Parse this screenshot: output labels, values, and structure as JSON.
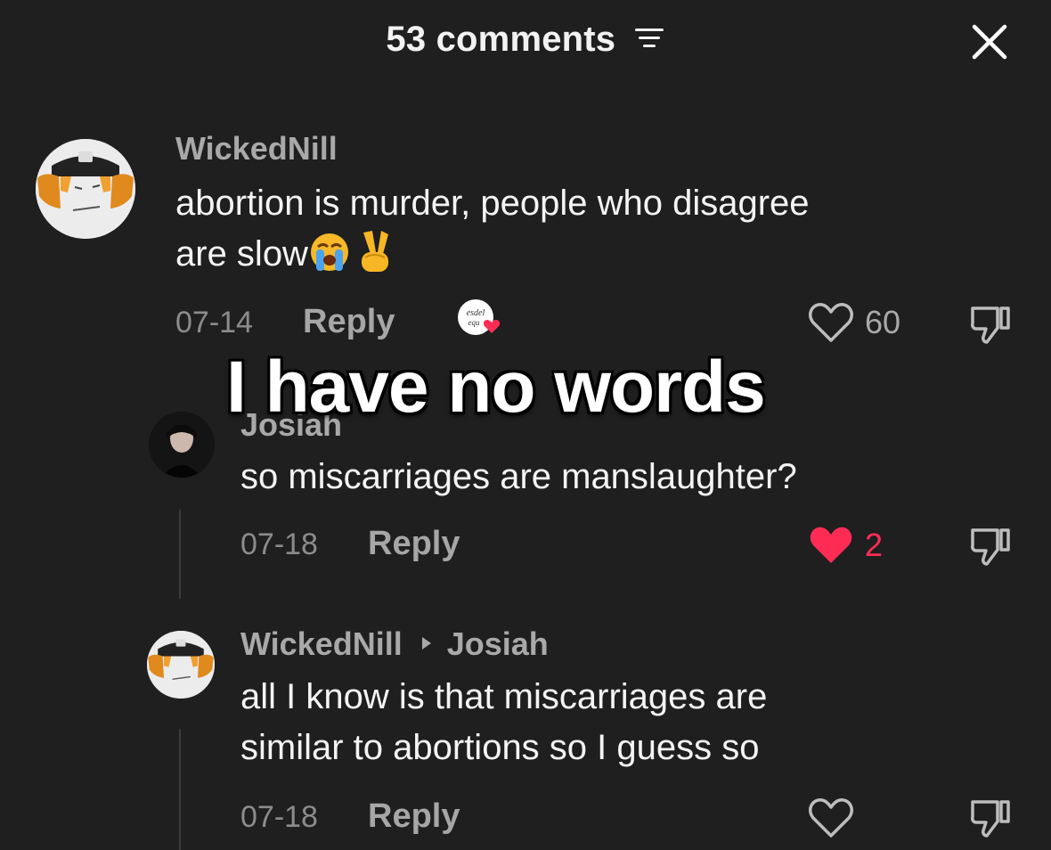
{
  "header": {
    "title": "53 comments"
  },
  "overlay": {
    "caption": "I have no words"
  },
  "comments": [
    {
      "username": "WickedNill",
      "text_line1": "abortion is murder, people who disagree",
      "text_line2": "are slow",
      "emojis": [
        "crying-face",
        "victory-hand"
      ],
      "date": "07-14",
      "reply_label": "Reply",
      "likes": "60",
      "liked_by_creator": true
    },
    {
      "username": "Josiah",
      "text_line1": "so miscarriages are manslaughter?",
      "date": "07-18",
      "reply_label": "Reply",
      "likes": "2",
      "liked": true
    },
    {
      "username": "WickedNill",
      "reply_to": "Josiah",
      "text_line1": "all I know is that miscarriages are",
      "text_line2": "similar to abortions so I guess so",
      "date": "07-18",
      "reply_label": "Reply",
      "likes": ""
    }
  ],
  "colors": {
    "background": "#1f1f1f",
    "liked_heart": "#fe2c55",
    "muted": "#a9a9a9"
  }
}
